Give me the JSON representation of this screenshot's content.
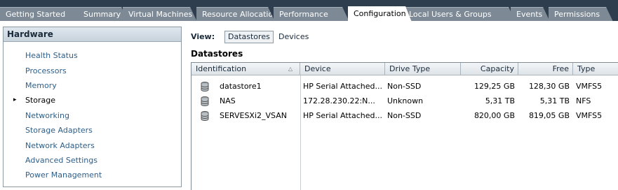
{
  "tabs": [
    {
      "label": "Getting Started"
    },
    {
      "label": "Summary"
    },
    {
      "label": "Virtual Machines"
    },
    {
      "label": "Resource Allocation"
    },
    {
      "label": "Performance"
    },
    {
      "label": "Configuration",
      "active": true
    },
    {
      "label": "Local Users & Groups"
    },
    {
      "label": "Events"
    },
    {
      "label": "Permissions"
    }
  ],
  "sidebar": {
    "header": "Hardware",
    "items": [
      {
        "label": "Health Status"
      },
      {
        "label": "Processors"
      },
      {
        "label": "Memory"
      },
      {
        "label": "Storage",
        "selected": true
      },
      {
        "label": "Networking"
      },
      {
        "label": "Storage Adapters"
      },
      {
        "label": "Network Adapters"
      },
      {
        "label": "Advanced Settings"
      },
      {
        "label": "Power Management"
      }
    ],
    "selected_marker": "▸"
  },
  "view": {
    "label": "View:",
    "options": [
      "Datastores",
      "Devices"
    ],
    "selected": "Datastores"
  },
  "section_title": "Datastores",
  "table": {
    "columns": [
      "Identification",
      "Device",
      "Drive Type",
      "Capacity",
      "Free",
      "Type"
    ],
    "sort_indicator": "△",
    "rows": [
      [
        "datastore1",
        "HP Serial Attached...",
        "Non-SSD",
        "129,25 GB",
        "128,30 GB",
        "VMFS5"
      ],
      [
        "NAS",
        "172.28.230.22:N...",
        "Unknown",
        "5,31 TB",
        "5,31 TB",
        "NFS"
      ],
      [
        "SERVESXi2_VSAN",
        "HP Serial Attached...",
        "Non-SSD",
        "820,00 GB",
        "819,05 GB",
        "VMFS5"
      ]
    ],
    "row_icon": "datastore-icon"
  },
  "colors": {
    "tabbar_bg": "#2f3e4e",
    "tab_inactive": "#7d8a95",
    "link": "#2d5e8a"
  }
}
